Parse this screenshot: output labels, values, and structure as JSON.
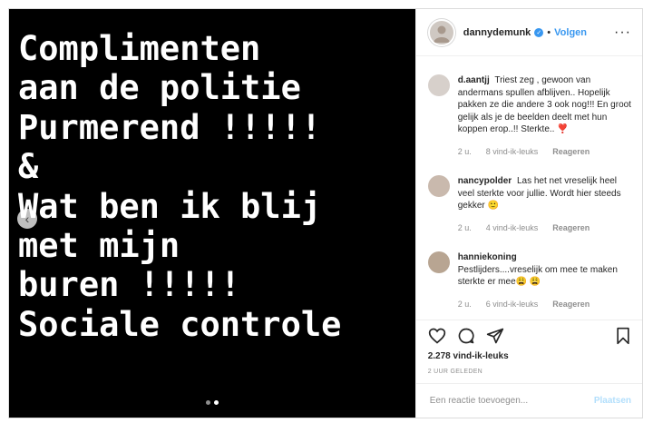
{
  "media": {
    "lines": [
      "Complimenten",
      "aan de politie",
      "Purmerend !!!!!",
      "&",
      "Wat ben ik blij",
      "met mijn",
      "buren !!!!!",
      "Sociale controle"
    ],
    "prev_arrow": "‹"
  },
  "header": {
    "username": "dannydemunk",
    "separator": "•",
    "follow_label": "Volgen",
    "more_label": "···"
  },
  "comments": [
    {
      "user": "d.aantjj",
      "text": "Triest zeg , gewoon van andermans spullen afblijven.. Hopelijk pakken ze die andere 3 ook nog!!! En groot gelijk als je de beelden deelt met hun koppen erop..!! Sterkte.. ❣️",
      "age": "2 u.",
      "likes": "8 vind-ik-leuks",
      "reply": "Reageren"
    },
    {
      "user": "nancypolder",
      "text": "Las het net vreselijk heel veel sterkte voor jullie. Wordt hier steeds gekker 🙂",
      "age": "2 u.",
      "likes": "4 vind-ik-leuks",
      "reply": "Reageren"
    },
    {
      "user": "hanniekoning",
      "text": "Pestlijders....vreselijk om mee te maken sterkte er mee😩 😩",
      "age": "2 u.",
      "likes": "6 vind-ik-leuks",
      "reply": "Reageren"
    }
  ],
  "footer": {
    "likes": "2.278 vind-ik-leuks",
    "time": "2 UUR GELEDEN",
    "comment_placeholder": "Een reactie toevoegen...",
    "post_label": "Plaatsen"
  },
  "colors": {
    "accent": "#3897f0",
    "post_disabled": "#b2dffc",
    "muted": "#8e8e8e",
    "media_bg": "#000000"
  }
}
